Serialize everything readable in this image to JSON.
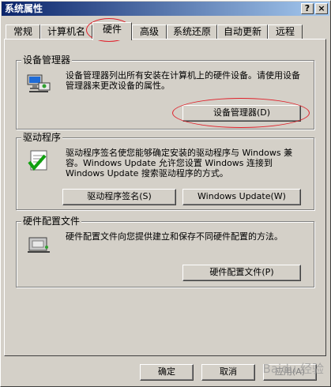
{
  "window": {
    "title": "系统属性",
    "help_btn": "?",
    "close_btn": "×"
  },
  "tabs": [
    {
      "label": "常规"
    },
    {
      "label": "计算机名"
    },
    {
      "label": "硬件"
    },
    {
      "label": "高级"
    },
    {
      "label": "系统还原"
    },
    {
      "label": "自动更新"
    },
    {
      "label": "远程"
    }
  ],
  "device_manager": {
    "title": "设备管理器",
    "description": "设备管理器列出所有安装在计算机上的硬件设备。请使用设备管理器来更改设备的属性。",
    "button": "设备管理器(D)"
  },
  "drivers": {
    "title": "驱动程序",
    "description": "驱动程序签名使您能够确定安装的驱动程序与 Windows 兼容。Windows Update 允许您设置 Windows 连接到 Windows Update 搜索驱动程序的方式。",
    "signing_button": "驱动程序签名(S)",
    "update_button": "Windows Update(W)"
  },
  "hardware_profiles": {
    "title": "硬件配置文件",
    "description": "硬件配置文件向您提供建立和保存不同硬件配置的方法。",
    "button": "硬件配置文件(P)"
  },
  "footer": {
    "ok": "确定",
    "cancel": "取消",
    "apply": "应用(A)"
  },
  "watermark": "Baidu 经验"
}
